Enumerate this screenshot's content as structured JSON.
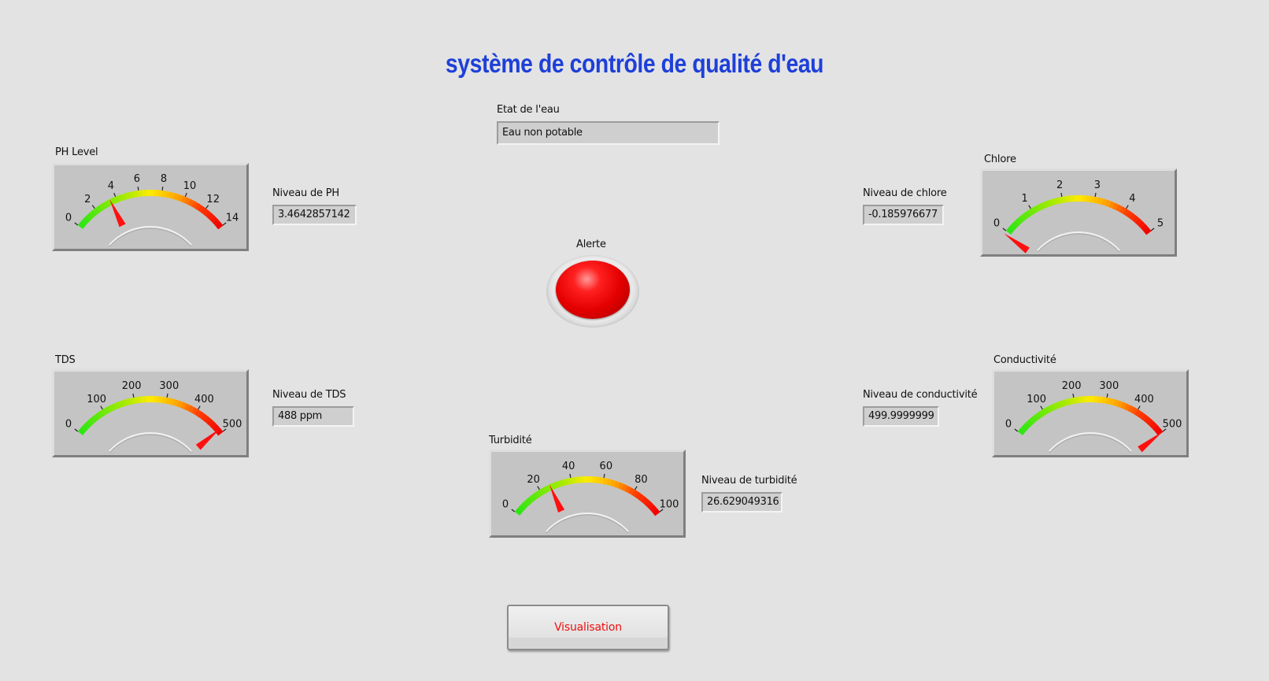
{
  "title": "système de contrôle de qualité d'eau",
  "etat": {
    "label": "Etat de l'eau",
    "value": "Eau non potable"
  },
  "alerte": {
    "label": "Alerte",
    "color": "#e40000",
    "state": "on"
  },
  "button": {
    "label": "Visualisation",
    "color": "#ee1010"
  },
  "gauges": [
    {
      "id": "ph",
      "label": "PH Level",
      "min": 0,
      "max": 14,
      "ticks": [
        0,
        2,
        4,
        6,
        8,
        10,
        12,
        14
      ],
      "value": 3.4642857142
    },
    {
      "id": "chlore",
      "label": "Chlore",
      "min": 0,
      "max": 5,
      "ticks": [
        0,
        1,
        2,
        3,
        4,
        5
      ],
      "value": -0.185976677
    },
    {
      "id": "tds",
      "label": "TDS",
      "min": 0,
      "max": 500,
      "ticks": [
        0,
        100,
        200,
        300,
        400,
        500
      ],
      "value": 488
    },
    {
      "id": "conduct",
      "label": "Conductivité",
      "min": 0,
      "max": 500,
      "ticks": [
        0,
        100,
        200,
        300,
        400,
        500
      ],
      "value": 499.9999999
    },
    {
      "id": "turb",
      "label": "Turbidité",
      "min": 0,
      "max": 100,
      "ticks": [
        0,
        20,
        40,
        60,
        80,
        100
      ],
      "value": 26.629049316
    }
  ],
  "readouts": {
    "ph": {
      "label": "Niveau de PH",
      "value": "3.4642857142"
    },
    "chlore": {
      "label": "Niveau de chlore",
      "value": "-0.185976677"
    },
    "tds": {
      "label": "Niveau de TDS",
      "value": "488  ppm"
    },
    "conduct": {
      "label": "Niveau de conductivité",
      "value": "499.9999999"
    },
    "turb": {
      "label": "Niveau de turbidité",
      "value": "26.629049316"
    }
  }
}
